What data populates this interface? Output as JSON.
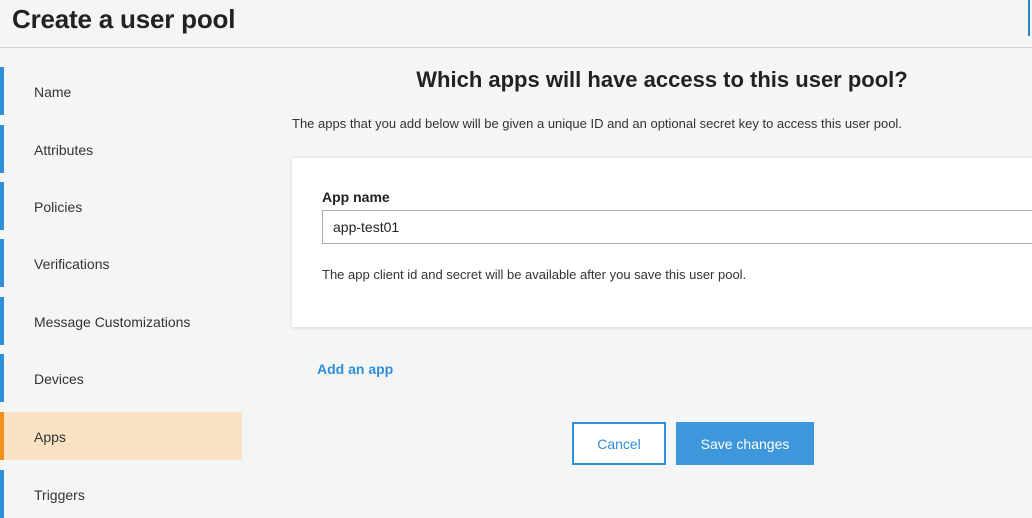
{
  "header": {
    "title": "Create a user pool"
  },
  "sidebar": {
    "items": [
      {
        "label": "Name"
      },
      {
        "label": "Attributes"
      },
      {
        "label": "Policies"
      },
      {
        "label": "Verifications"
      },
      {
        "label": "Message Customizations"
      },
      {
        "label": "Devices"
      },
      {
        "label": "Apps",
        "active": true
      },
      {
        "label": "Triggers"
      }
    ]
  },
  "main": {
    "title": "Which apps will have access to this user pool?",
    "subtitle": "The apps that you add below will be given a unique ID and an optional secret key to access this user pool.",
    "card": {
      "field_label": "App name",
      "input_value": "app-test01",
      "help_text": "The app client id and secret will be available after you save this user pool."
    },
    "add_link": "Add an app",
    "buttons": {
      "cancel": "Cancel",
      "save": "Save changes"
    }
  },
  "colors": {
    "accent": "#2f8fd8",
    "active_border": "#f28f1c",
    "active_bg": "#f9e3c4",
    "page_bg": "#f4f5f5"
  }
}
